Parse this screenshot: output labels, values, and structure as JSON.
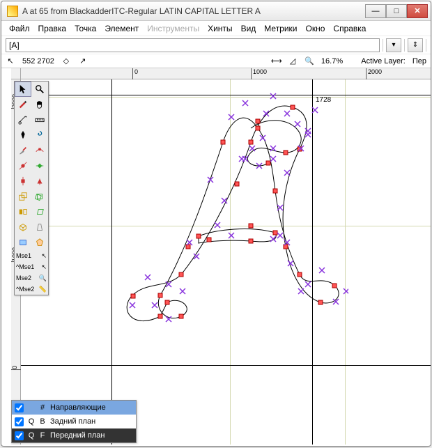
{
  "window": {
    "title": "A at 65 from BlackadderITC-Regular LATIN CAPITAL LETTER A"
  },
  "menu": {
    "file": "Файл",
    "edit": "Правка",
    "point": "Точка",
    "element": "Элемент",
    "tools": "Инструменты",
    "hints": "Хинты",
    "view": "Вид",
    "metrics": "Метрики",
    "window": "Окно",
    "help": "Справка"
  },
  "search": {
    "value": "[A]"
  },
  "status": {
    "coords": "552 2702",
    "zoom": "16.7%",
    "active_layer_label": "Active Layer:",
    "active_layer_value": "Пер"
  },
  "ruler": {
    "x0": "0",
    "x1000": "1000",
    "x2000": "2000",
    "y0": "0",
    "y1000": "1000",
    "y2000": "2000"
  },
  "advance": {
    "value": "1728"
  },
  "mouse_labels": {
    "m1": "Mse1",
    "m1b": "^Mse1",
    "m2": "Mse2",
    "m2b": "^Mse2"
  },
  "layers": {
    "hash": "#",
    "guides": "Направляющие",
    "q": "Q",
    "b": "B",
    "back": "Задний план",
    "f": "F",
    "fore": "Передний план"
  }
}
